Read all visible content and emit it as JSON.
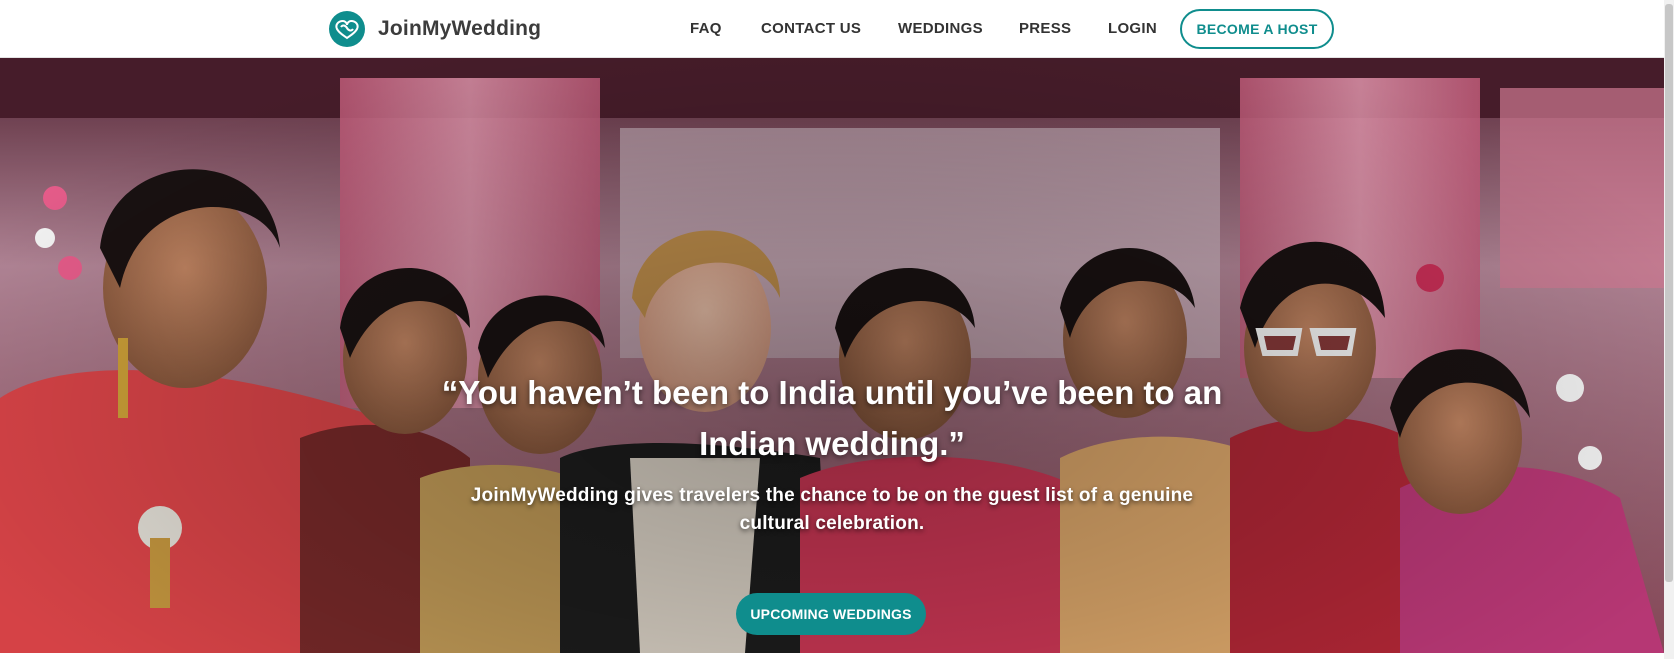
{
  "header": {
    "brand_name": "JoinMyWedding",
    "logo_icon": "interlocking-hearts-icon",
    "nav": {
      "faq": "FAQ",
      "contact": "CONTACT US",
      "weddings": "WEDDINGS",
      "press": "PRESS",
      "login": "LOGIN"
    },
    "host_button": "BECOME A HOST"
  },
  "hero": {
    "quote": "“You haven’t been to India until you’ve been to an Indian wedding.”",
    "subtitle": "JoinMyWedding gives travelers the chance to be on the guest list of a genuine cultural celebration.",
    "cta": "UPCOMING WEDDINGS"
  },
  "colors": {
    "brand_teal": "#0f8d8d",
    "nav_text": "#333333",
    "white": "#ffffff"
  }
}
